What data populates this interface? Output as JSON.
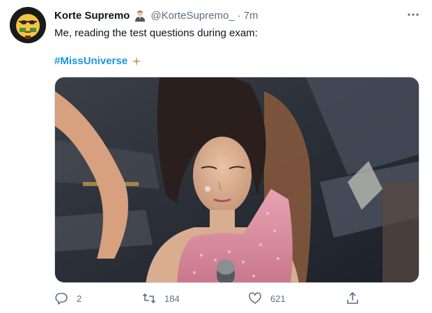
{
  "tweet": {
    "author_name": "Korte Supremo",
    "author_handle": "@KorteSupremo_",
    "separator": "·",
    "time": "7m",
    "text": "Me, reading the test questions during exam:",
    "hashtag": "#MissUniverse"
  },
  "actions": {
    "reply_count": "2",
    "retweet_count": "184",
    "like_count": "621"
  },
  "icons": {
    "more": "more-horizontal-icon",
    "reply": "reply-icon",
    "retweet": "retweet-icon",
    "like": "heart-icon",
    "share": "share-icon"
  },
  "colors": {
    "text": "#0f1419",
    "secondary": "#5b7083",
    "link": "#1b95e0",
    "border": "#cfd9de"
  }
}
